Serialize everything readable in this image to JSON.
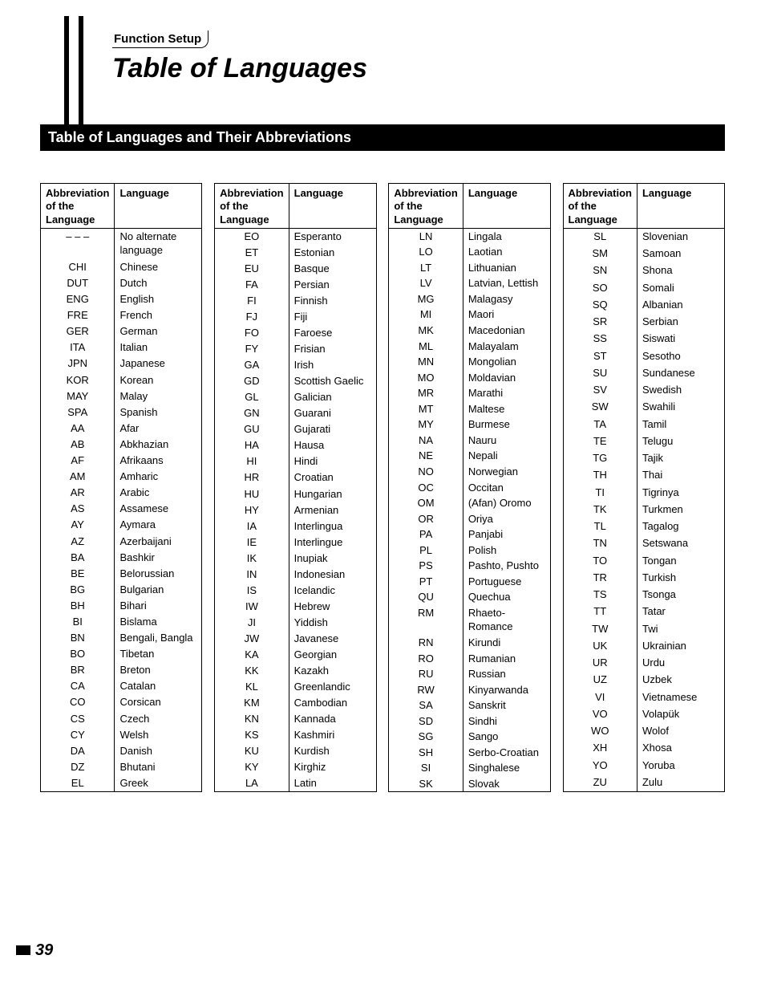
{
  "header": {
    "tab": "Function Setup",
    "title": "Table of Languages"
  },
  "section_bar": "Table of Languages and Their Abbreviations",
  "columns_header": {
    "abbr": "Abbreviation of the Language",
    "lang": "Language"
  },
  "tables": [
    [
      {
        "abbr": "– – –",
        "lang": "No alternate language"
      },
      {
        "abbr": "CHI",
        "lang": "Chinese"
      },
      {
        "abbr": "DUT",
        "lang": "Dutch"
      },
      {
        "abbr": "ENG",
        "lang": "English"
      },
      {
        "abbr": "FRE",
        "lang": "French"
      },
      {
        "abbr": "GER",
        "lang": "German"
      },
      {
        "abbr": "ITA",
        "lang": "Italian"
      },
      {
        "abbr": "JPN",
        "lang": "Japanese"
      },
      {
        "abbr": "KOR",
        "lang": "Korean"
      },
      {
        "abbr": "MAY",
        "lang": "Malay"
      },
      {
        "abbr": "SPA",
        "lang": "Spanish"
      },
      {
        "abbr": "AA",
        "lang": "Afar"
      },
      {
        "abbr": "AB",
        "lang": "Abkhazian"
      },
      {
        "abbr": "AF",
        "lang": "Afrikaans"
      },
      {
        "abbr": "AM",
        "lang": "Amharic"
      },
      {
        "abbr": "AR",
        "lang": "Arabic"
      },
      {
        "abbr": "AS",
        "lang": "Assamese"
      },
      {
        "abbr": "AY",
        "lang": "Aymara"
      },
      {
        "abbr": "AZ",
        "lang": "Azerbaijani"
      },
      {
        "abbr": "BA",
        "lang": "Bashkir"
      },
      {
        "abbr": "BE",
        "lang": "Belorussian"
      },
      {
        "abbr": "BG",
        "lang": "Bulgarian"
      },
      {
        "abbr": "BH",
        "lang": "Bihari"
      },
      {
        "abbr": "BI",
        "lang": "Bislama"
      },
      {
        "abbr": "BN",
        "lang": "Bengali, Bangla"
      },
      {
        "abbr": "BO",
        "lang": "Tibetan"
      },
      {
        "abbr": "BR",
        "lang": "Breton"
      },
      {
        "abbr": "CA",
        "lang": "Catalan"
      },
      {
        "abbr": "CO",
        "lang": "Corsican"
      },
      {
        "abbr": "CS",
        "lang": "Czech"
      },
      {
        "abbr": "CY",
        "lang": "Welsh"
      },
      {
        "abbr": "DA",
        "lang": "Danish"
      },
      {
        "abbr": "DZ",
        "lang": "Bhutani"
      },
      {
        "abbr": "EL",
        "lang": "Greek"
      }
    ],
    [
      {
        "abbr": "EO",
        "lang": "Esperanto"
      },
      {
        "abbr": "ET",
        "lang": "Estonian"
      },
      {
        "abbr": "EU",
        "lang": "Basque"
      },
      {
        "abbr": "FA",
        "lang": "Persian"
      },
      {
        "abbr": "FI",
        "lang": "Finnish"
      },
      {
        "abbr": "FJ",
        "lang": "Fiji"
      },
      {
        "abbr": "FO",
        "lang": "Faroese"
      },
      {
        "abbr": "FY",
        "lang": "Frisian"
      },
      {
        "abbr": "GA",
        "lang": "Irish"
      },
      {
        "abbr": "GD",
        "lang": "Scottish Gaelic"
      },
      {
        "abbr": "GL",
        "lang": "Galician"
      },
      {
        "abbr": "GN",
        "lang": "Guarani"
      },
      {
        "abbr": "GU",
        "lang": "Gujarati"
      },
      {
        "abbr": "HA",
        "lang": "Hausa"
      },
      {
        "abbr": "HI",
        "lang": "Hindi"
      },
      {
        "abbr": "HR",
        "lang": "Croatian"
      },
      {
        "abbr": "HU",
        "lang": "Hungarian"
      },
      {
        "abbr": "HY",
        "lang": "Armenian"
      },
      {
        "abbr": "IA",
        "lang": "Interlingua"
      },
      {
        "abbr": "IE",
        "lang": "Interlingue"
      },
      {
        "abbr": "IK",
        "lang": "Inupiak"
      },
      {
        "abbr": "IN",
        "lang": "Indonesian"
      },
      {
        "abbr": "IS",
        "lang": "Icelandic"
      },
      {
        "abbr": "IW",
        "lang": "Hebrew"
      },
      {
        "abbr": "JI",
        "lang": "Yiddish"
      },
      {
        "abbr": "JW",
        "lang": "Javanese"
      },
      {
        "abbr": "KA",
        "lang": "Georgian"
      },
      {
        "abbr": "KK",
        "lang": "Kazakh"
      },
      {
        "abbr": "KL",
        "lang": "Greenlandic"
      },
      {
        "abbr": "KM",
        "lang": "Cambodian"
      },
      {
        "abbr": "KN",
        "lang": "Kannada"
      },
      {
        "abbr": "KS",
        "lang": "Kashmiri"
      },
      {
        "abbr": "KU",
        "lang": "Kurdish"
      },
      {
        "abbr": "KY",
        "lang": "Kirghiz"
      },
      {
        "abbr": "LA",
        "lang": "Latin"
      }
    ],
    [
      {
        "abbr": "LN",
        "lang": "Lingala"
      },
      {
        "abbr": "LO",
        "lang": "Laotian"
      },
      {
        "abbr": "LT",
        "lang": "Lithuanian"
      },
      {
        "abbr": "LV",
        "lang": "Latvian, Lettish"
      },
      {
        "abbr": "MG",
        "lang": "Malagasy"
      },
      {
        "abbr": "MI",
        "lang": "Maori"
      },
      {
        "abbr": "MK",
        "lang": "Macedonian"
      },
      {
        "abbr": "ML",
        "lang": "Malayalam"
      },
      {
        "abbr": "MN",
        "lang": "Mongolian"
      },
      {
        "abbr": "MO",
        "lang": "Moldavian"
      },
      {
        "abbr": "MR",
        "lang": "Marathi"
      },
      {
        "abbr": "MT",
        "lang": "Maltese"
      },
      {
        "abbr": "MY",
        "lang": "Burmese"
      },
      {
        "abbr": "NA",
        "lang": "Nauru"
      },
      {
        "abbr": "NE",
        "lang": "Nepali"
      },
      {
        "abbr": "NO",
        "lang": "Norwegian"
      },
      {
        "abbr": "OC",
        "lang": "Occitan"
      },
      {
        "abbr": "OM",
        "lang": "(Afan) Oromo"
      },
      {
        "abbr": "OR",
        "lang": "Oriya"
      },
      {
        "abbr": "PA",
        "lang": "Panjabi"
      },
      {
        "abbr": "PL",
        "lang": "Polish"
      },
      {
        "abbr": "PS",
        "lang": "Pashto, Pushto"
      },
      {
        "abbr": "PT",
        "lang": "Portuguese"
      },
      {
        "abbr": "QU",
        "lang": "Quechua"
      },
      {
        "abbr": "RM",
        "lang": "Rhaeto-Romance"
      },
      {
        "abbr": "RN",
        "lang": "Kirundi"
      },
      {
        "abbr": "RO",
        "lang": "Rumanian"
      },
      {
        "abbr": "RU",
        "lang": "Russian"
      },
      {
        "abbr": "RW",
        "lang": "Kinyarwanda"
      },
      {
        "abbr": "SA",
        "lang": "Sanskrit"
      },
      {
        "abbr": "SD",
        "lang": "Sindhi"
      },
      {
        "abbr": "SG",
        "lang": "Sango"
      },
      {
        "abbr": "SH",
        "lang": "Serbo-Croatian"
      },
      {
        "abbr": "SI",
        "lang": "Singhalese"
      },
      {
        "abbr": "SK",
        "lang": "Slovak"
      }
    ],
    [
      {
        "abbr": "SL",
        "lang": "Slovenian"
      },
      {
        "abbr": "SM",
        "lang": "Samoan"
      },
      {
        "abbr": "SN",
        "lang": "Shona"
      },
      {
        "abbr": "SO",
        "lang": "Somali"
      },
      {
        "abbr": "SQ",
        "lang": "Albanian"
      },
      {
        "abbr": "SR",
        "lang": "Serbian"
      },
      {
        "abbr": "SS",
        "lang": "Siswati"
      },
      {
        "abbr": "ST",
        "lang": "Sesotho"
      },
      {
        "abbr": "SU",
        "lang": "Sundanese"
      },
      {
        "abbr": "SV",
        "lang": "Swedish"
      },
      {
        "abbr": "SW",
        "lang": "Swahili"
      },
      {
        "abbr": "TA",
        "lang": "Tamil"
      },
      {
        "abbr": "TE",
        "lang": "Telugu"
      },
      {
        "abbr": "TG",
        "lang": "Tajik"
      },
      {
        "abbr": "TH",
        "lang": "Thai"
      },
      {
        "abbr": "TI",
        "lang": "Tigrinya"
      },
      {
        "abbr": "TK",
        "lang": "Turkmen"
      },
      {
        "abbr": "TL",
        "lang": "Tagalog"
      },
      {
        "abbr": "TN",
        "lang": "Setswana"
      },
      {
        "abbr": "TO",
        "lang": "Tongan"
      },
      {
        "abbr": "TR",
        "lang": "Turkish"
      },
      {
        "abbr": "TS",
        "lang": "Tsonga"
      },
      {
        "abbr": "TT",
        "lang": "Tatar"
      },
      {
        "abbr": "TW",
        "lang": "Twi"
      },
      {
        "abbr": "UK",
        "lang": "Ukrainian"
      },
      {
        "abbr": "UR",
        "lang": "Urdu"
      },
      {
        "abbr": "UZ",
        "lang": "Uzbek"
      },
      {
        "abbr": "VI",
        "lang": "Vietnamese"
      },
      {
        "abbr": "VO",
        "lang": "Volapük"
      },
      {
        "abbr": "WO",
        "lang": "Wolof"
      },
      {
        "abbr": "XH",
        "lang": "Xhosa"
      },
      {
        "abbr": "YO",
        "lang": "Yoruba"
      },
      {
        "abbr": "ZU",
        "lang": "Zulu"
      }
    ]
  ],
  "page_number": "39"
}
